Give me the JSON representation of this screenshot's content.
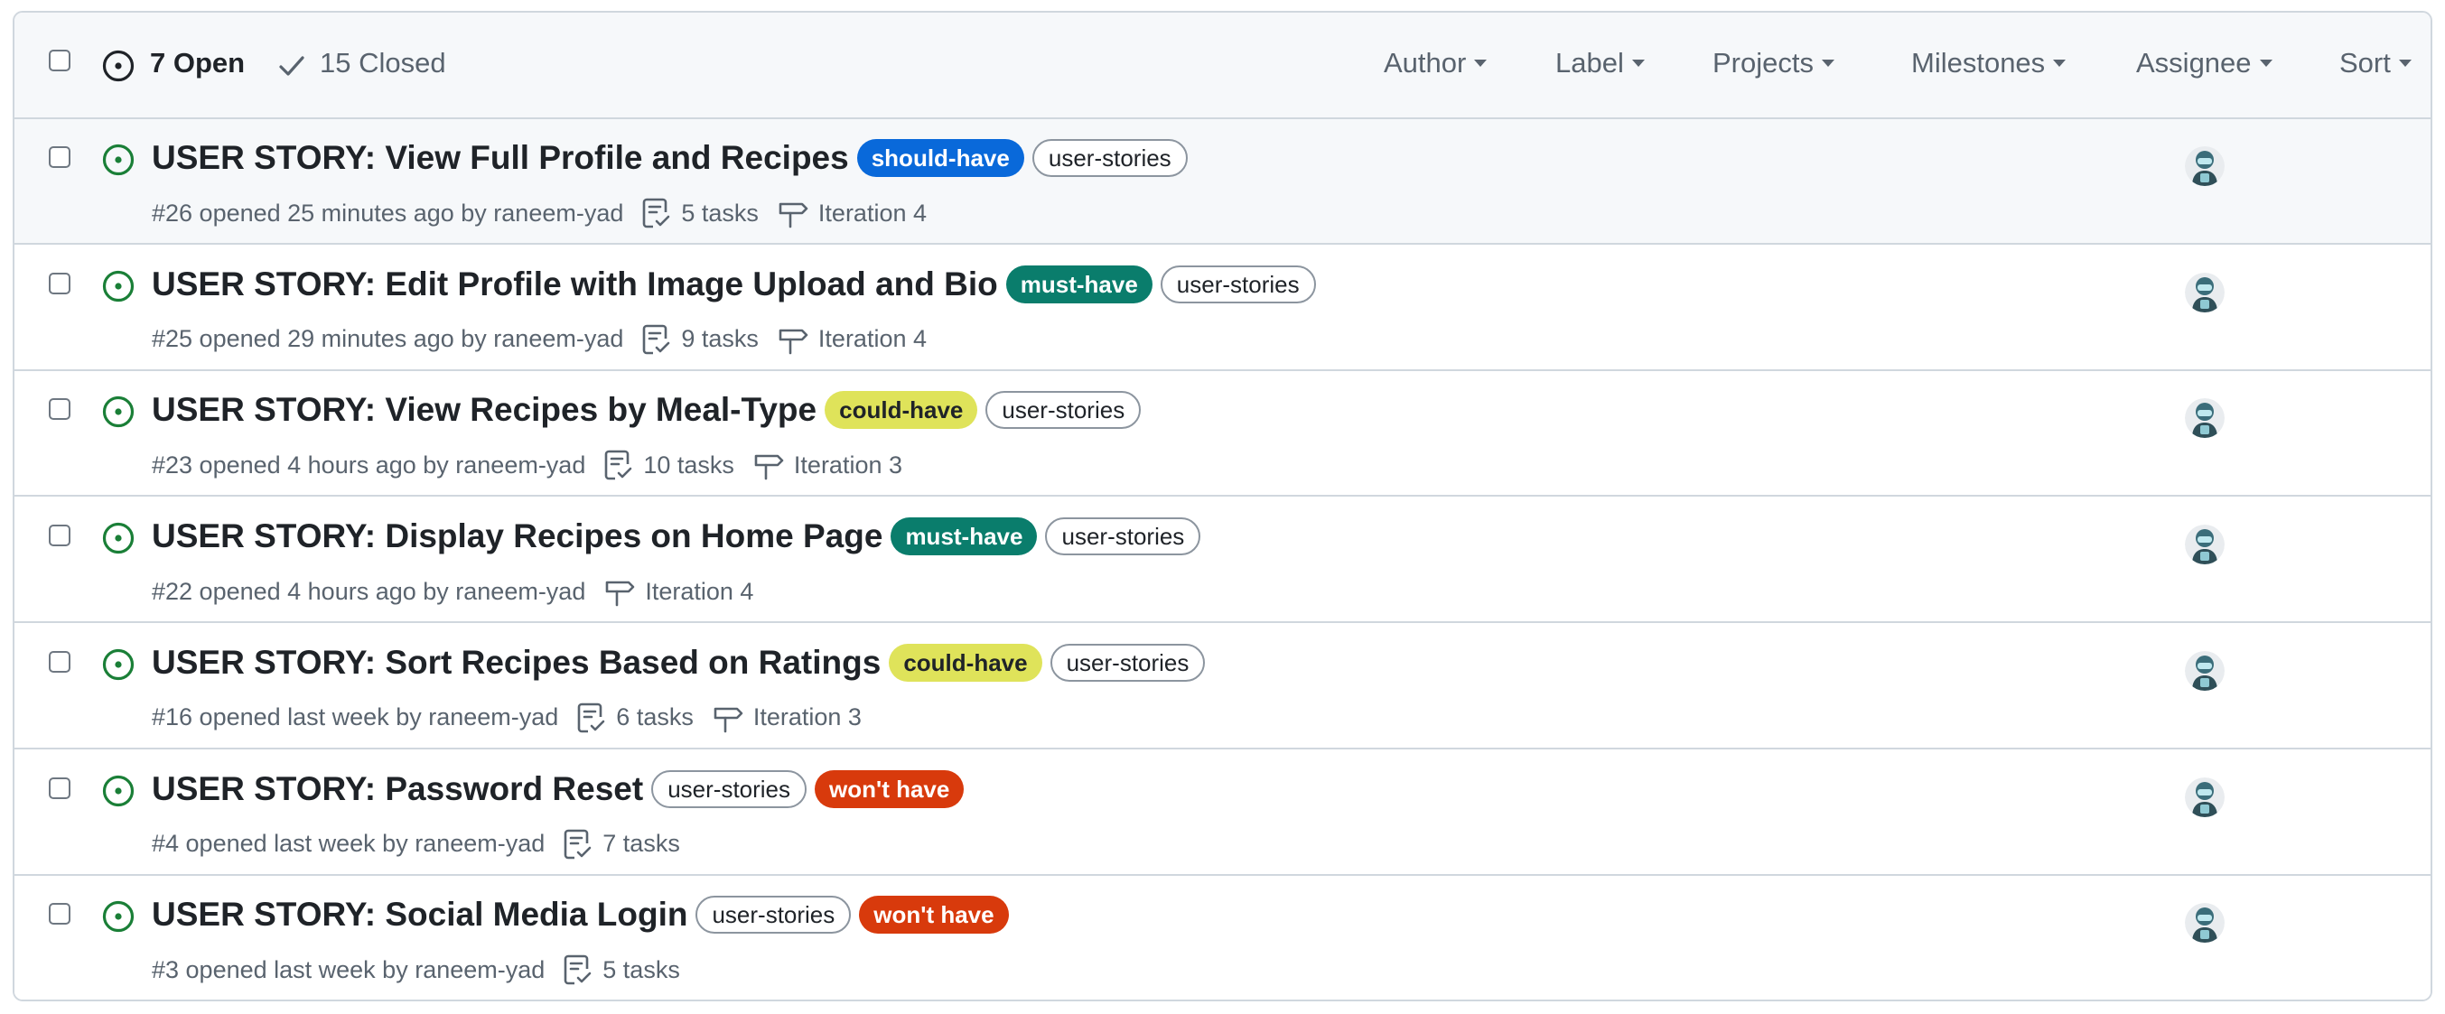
{
  "header": {
    "open_label": "7 Open",
    "closed_label": "15 Closed",
    "filters": [
      "Author",
      "Label",
      "Projects",
      "Milestones",
      "Assignee",
      "Sort"
    ]
  },
  "colors": {
    "open_green": "#1a7f37",
    "should_have": "#0969da",
    "must_have": "#0a7d6c",
    "could_have": "#dfe35a",
    "wont_have": "#d83a0c"
  },
  "issues": [
    {
      "title": "USER STORY: View Full Profile and Recipes",
      "labels": [
        {
          "text": "should-have",
          "style": "should_have"
        },
        {
          "text": "user-stories",
          "style": "outline"
        }
      ],
      "meta": "#26 opened 25 minutes ago by raneem-yad",
      "tasks": "5 tasks",
      "iteration": "Iteration 4"
    },
    {
      "title": "USER STORY: Edit Profile with Image Upload and Bio",
      "labels": [
        {
          "text": "must-have",
          "style": "must_have"
        },
        {
          "text": "user-stories",
          "style": "outline"
        }
      ],
      "meta": "#25 opened 29 minutes ago by raneem-yad",
      "tasks": "9 tasks",
      "iteration": "Iteration 4"
    },
    {
      "title": "USER STORY: View Recipes by Meal-Type",
      "labels": [
        {
          "text": "could-have",
          "style": "could_have"
        },
        {
          "text": "user-stories",
          "style": "outline"
        }
      ],
      "meta": "#23 opened 4 hours ago by raneem-yad",
      "tasks": "10 tasks",
      "iteration": "Iteration 3"
    },
    {
      "title": "USER STORY: Display Recipes on Home Page",
      "labels": [
        {
          "text": "must-have",
          "style": "must_have"
        },
        {
          "text": "user-stories",
          "style": "outline"
        }
      ],
      "meta": "#22 opened 4 hours ago by raneem-yad",
      "tasks": "",
      "iteration": "Iteration 4"
    },
    {
      "title": "USER STORY: Sort Recipes Based on Ratings",
      "labels": [
        {
          "text": "could-have",
          "style": "could_have"
        },
        {
          "text": "user-stories",
          "style": "outline"
        }
      ],
      "meta": "#16 opened last week by raneem-yad",
      "tasks": "6 tasks",
      "iteration": "Iteration 3"
    },
    {
      "title": "USER STORY: Password Reset",
      "labels": [
        {
          "text": "user-stories",
          "style": "outline"
        },
        {
          "text": "won't have",
          "style": "wont_have"
        }
      ],
      "meta": "#4 opened last week by raneem-yad",
      "tasks": "7 tasks",
      "iteration": ""
    },
    {
      "title": "USER STORY: Social Media Login",
      "labels": [
        {
          "text": "user-stories",
          "style": "outline"
        },
        {
          "text": "won't have",
          "style": "wont_have"
        }
      ],
      "meta": "#3 opened last week by raneem-yad",
      "tasks": "5 tasks",
      "iteration": ""
    }
  ]
}
